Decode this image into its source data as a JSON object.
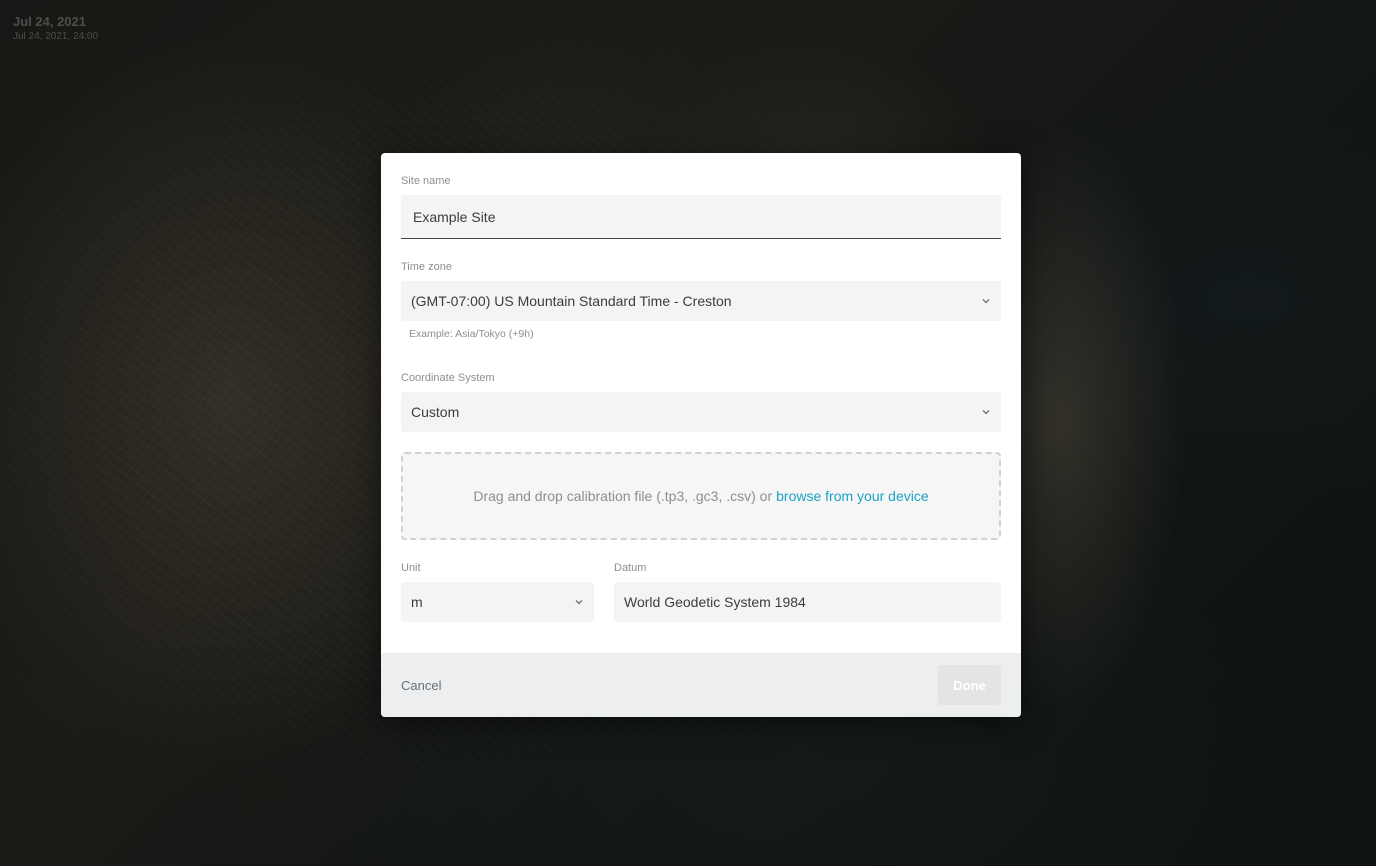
{
  "map": {
    "date_primary": "Jul 24, 2021",
    "date_secondary": "Jul 24, 2021, 24:00"
  },
  "dialog": {
    "site_name": {
      "label": "Site name",
      "value": "Example Site"
    },
    "time_zone": {
      "label": "Time zone",
      "selected": "(GMT-07:00) US Mountain Standard Time - Creston",
      "helper": "Example: Asia/Tokyo (+9h)"
    },
    "coordinate_system": {
      "label": "Coordinate System",
      "selected": "Custom"
    },
    "dropzone": {
      "text": "Drag and drop calibration file (.tp3, .gc3, .csv) or",
      "link": "browse from your device"
    },
    "unit": {
      "label": "Unit",
      "selected": "m"
    },
    "datum": {
      "label": "Datum",
      "value": "World Geodetic System 1984"
    },
    "footer": {
      "cancel_label": "Cancel",
      "done_label": "Done"
    }
  },
  "colors": {
    "link": "#1ba3c6",
    "footer_bg": "#eceeef",
    "field_bg": "#f4f4f4"
  },
  "icons": {
    "select_indicator": "chevron-down-icon"
  }
}
